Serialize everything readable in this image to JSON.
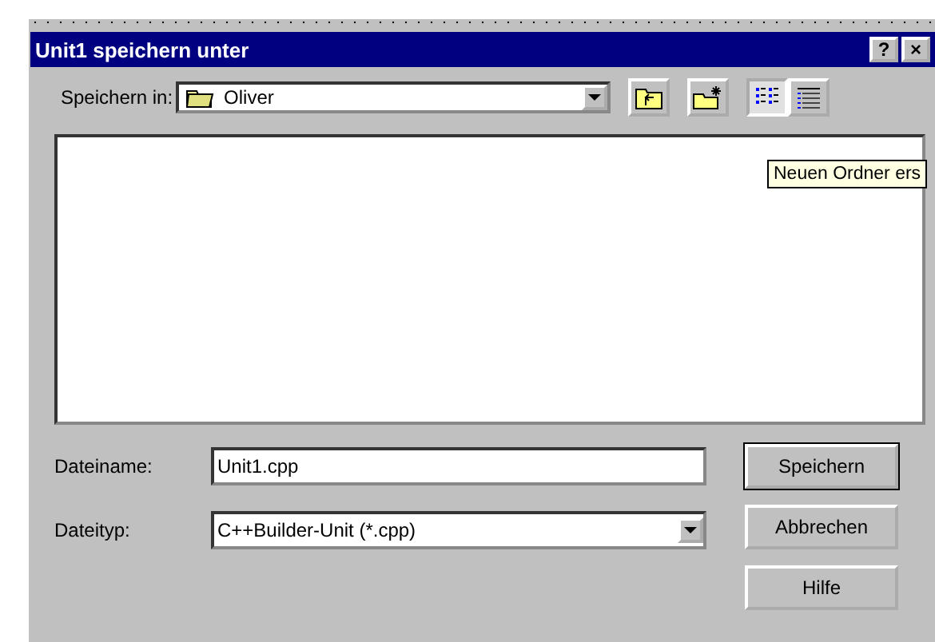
{
  "window": {
    "title": "Unit1 speichern unter",
    "title_buttons": [
      "?",
      "×"
    ]
  },
  "save_in": {
    "label": "Speichern in:",
    "value": "Oliver"
  },
  "tooltip": "Neuen Ordner ers",
  "view_buttons": [
    {
      "kind": "list",
      "selected": true
    },
    {
      "kind": "details",
      "selected": false
    }
  ],
  "fields": [
    {
      "kind": "text",
      "label": "Dateiname:",
      "value": "Unit1.cpp"
    },
    {
      "kind": "dropdown",
      "label": "Dateityp:",
      "value": "C++Builder-Unit (*.cpp)"
    }
  ],
  "buttons": [
    {
      "label": "Speichern",
      "default": true
    },
    {
      "label": "Abbrechen",
      "default": false
    },
    {
      "label": "Hilfe",
      "default": false
    }
  ]
}
